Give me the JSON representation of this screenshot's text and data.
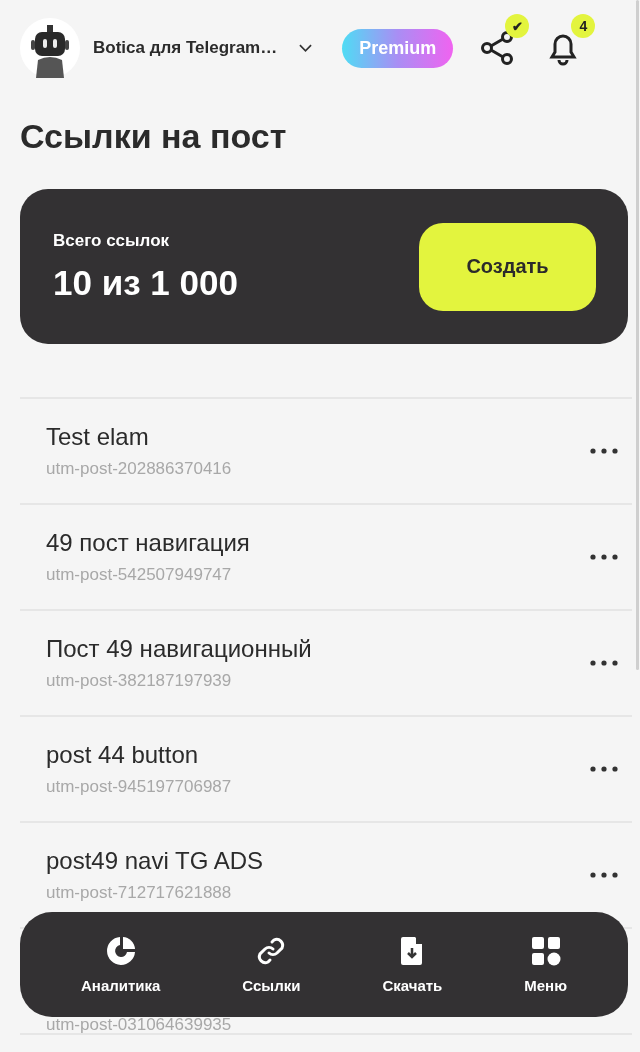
{
  "header": {
    "bot_name": "Botica для Telegram…",
    "premium": "Premium",
    "share_badge": "✔",
    "notifications_count": "4"
  },
  "title": "Ссылки на пост",
  "summary": {
    "label": "Всего ссылок",
    "value": "10 из 1 000",
    "button": "Создать"
  },
  "links": [
    {
      "title": "Test elam",
      "subtitle": "utm-post-202886370416"
    },
    {
      "title": "49 пост навигация",
      "subtitle": "utm-post-542507949747"
    },
    {
      "title": "Пост 49 навигационный",
      "subtitle": "utm-post-382187197939"
    },
    {
      "title": "post 44 button",
      "subtitle": "utm-post-945197706987"
    },
    {
      "title": "post49 navi TG ADS",
      "subtitle": "utm-post-712717621888"
    },
    {
      "subtitle": "utm-post-031064639935"
    }
  ],
  "bottom_nav": [
    {
      "kind": "analytics",
      "label": "Аналитика"
    },
    {
      "kind": "links",
      "label": "Ссылки"
    },
    {
      "kind": "download",
      "label": "Скачать"
    },
    {
      "kind": "menu",
      "label": "Меню"
    }
  ]
}
